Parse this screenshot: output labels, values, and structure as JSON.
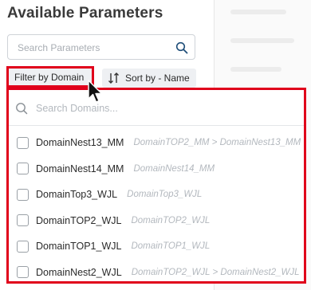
{
  "panel": {
    "title": "Available Parameters",
    "search": {
      "placeholder": "Search Parameters",
      "value": ""
    },
    "filter_label": "Filter by Domain",
    "sort_label": "Sort by - Name"
  },
  "dropdown": {
    "search": {
      "placeholder": "Search Domains...",
      "value": ""
    },
    "items": [
      {
        "name": "DomainNest13_MM",
        "path": "DomainTOP2_MM > DomainNest13_MM",
        "checked": false
      },
      {
        "name": "DomainNest14_MM",
        "path": "DomainNest14_MM",
        "checked": false
      },
      {
        "name": "DomainTop3_WJL",
        "path": "DomainTop3_WJL",
        "checked": false
      },
      {
        "name": "DomainTOP2_WJL",
        "path": "DomainTOP2_WJL",
        "checked": false
      },
      {
        "name": "DomainTOP1_WJL",
        "path": "DomainTOP1_WJL",
        "checked": false
      },
      {
        "name": "DomainNest2_WJL",
        "path": "DomainTOP2_WJL > DomainNest2_WJL",
        "checked": false
      }
    ]
  },
  "colors": {
    "highlight": "#e0001b",
    "button_bg": "#eef0f3",
    "muted_text": "#b3b8be"
  },
  "icons": [
    "search-icon",
    "sort-icon",
    "cursor-icon"
  ]
}
